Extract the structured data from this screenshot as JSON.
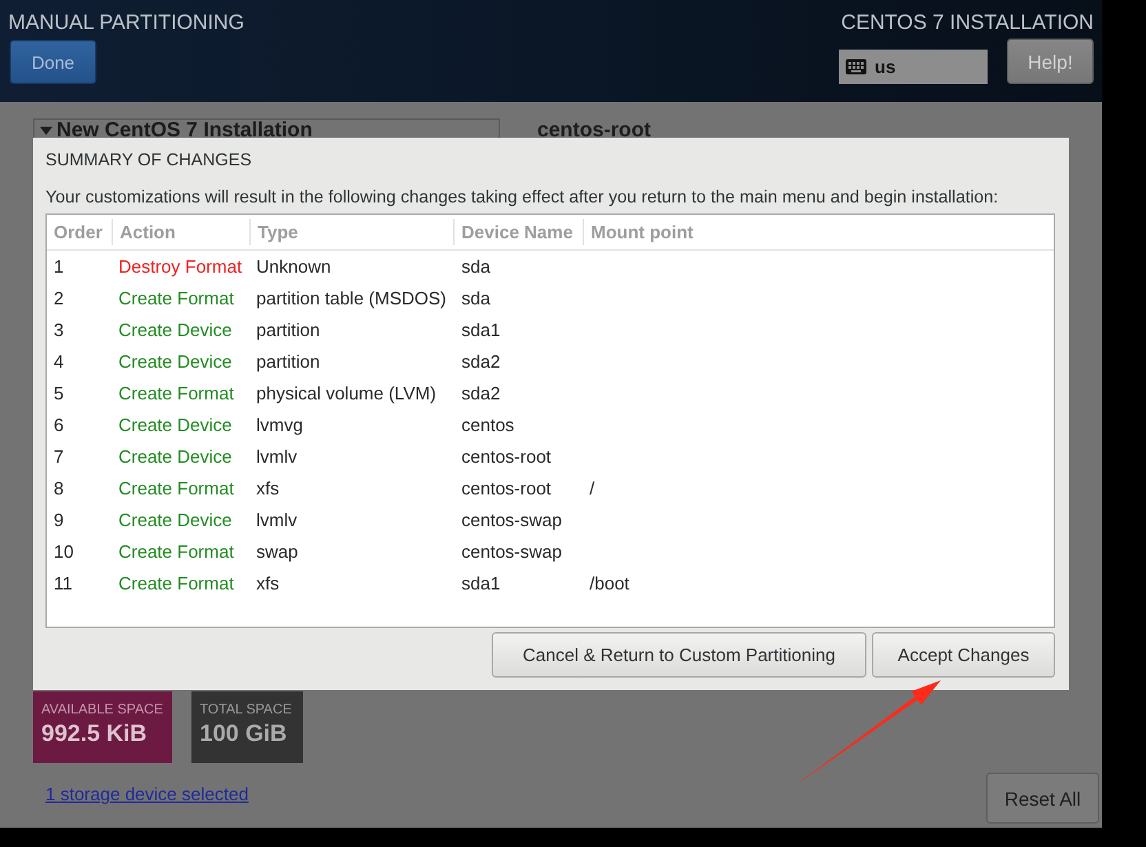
{
  "header": {
    "title": "MANUAL PARTITIONING",
    "done_button": "Done",
    "product": "CENTOS 7 INSTALLATION",
    "keyboard_layout": "us",
    "help_button": "Help!"
  },
  "partitions_panel": {
    "title": "New CentOS 7 Installation",
    "expanded": true
  },
  "detail": {
    "title": "centos-root"
  },
  "space": {
    "available_label": "AVAILABLE SPACE",
    "available_value": "992.5 KiB",
    "total_label": "TOTAL SPACE",
    "total_value": "100 GiB"
  },
  "storage_link": "1 storage device selected",
  "reset_button": "Reset All",
  "dialog": {
    "title": "SUMMARY OF CHANGES",
    "description": "Your customizations will result in the following changes taking effect after you return to the main menu and begin installation:",
    "columns": [
      "Order",
      "Action",
      "Type",
      "Device Name",
      "Mount point"
    ],
    "rows": [
      {
        "order": "1",
        "action": "Destroy Format",
        "color": "#ee2222",
        "type": "Unknown",
        "device_name": "sda"
      },
      {
        "order": "2",
        "action": "Create Format",
        "color": "#238c23",
        "type": "partition table (MSDOS)",
        "device_name": "sda"
      },
      {
        "order": "3",
        "action": "Create Device",
        "color": "#238c23",
        "type": "partition",
        "device_name": "sda1"
      },
      {
        "order": "4",
        "action": "Create Device",
        "color": "#238c23",
        "type": "partition",
        "device_name": "sda2"
      },
      {
        "order": "5",
        "action": "Create Format",
        "color": "#238c23",
        "type": "physical volume (LVM)",
        "device_name": "sda2"
      },
      {
        "order": "6",
        "action": "Create Device",
        "color": "#238c23",
        "type": "lvmvg",
        "device_name": "centos"
      },
      {
        "order": "7",
        "action": "Create Device",
        "color": "#238c23",
        "type": "lvmlv",
        "device_name": "centos-root"
      },
      {
        "order": "8",
        "action": "Create Format",
        "color": "#238c23",
        "type": "xfs",
        "device_name": "centos-root",
        "mount_point": "/"
      },
      {
        "order": "9",
        "action": "Create Device",
        "color": "#238c23",
        "type": "lvmlv",
        "device_name": "centos-swap"
      },
      {
        "order": "10",
        "action": "Create Format",
        "color": "#238c23",
        "type": "swap",
        "device_name": "centos-swap"
      },
      {
        "order": "11",
        "action": "Create Format",
        "color": "#238c23",
        "type": "xfs",
        "device_name": "sda1",
        "mount_point": "/boot"
      }
    ],
    "buttons": [
      "Cancel & Return to Custom Partitioning",
      "Accept Changes"
    ]
  }
}
